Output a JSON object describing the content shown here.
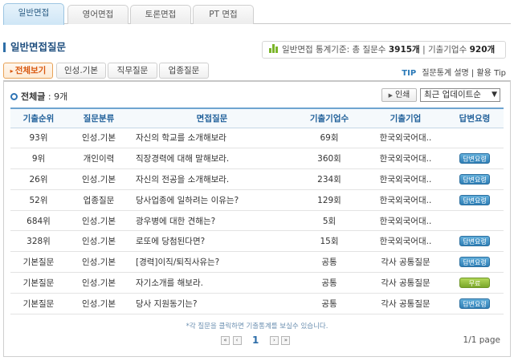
{
  "top_tabs": [
    {
      "label": "일반면접",
      "active": true
    },
    {
      "label": "영어면접",
      "active": false
    },
    {
      "label": "토론면접",
      "active": false
    },
    {
      "label": "PT 면접",
      "active": false
    }
  ],
  "section_title": "일반면접질문",
  "stats": {
    "prefix": "일반면접 통계기준: 총 질문수",
    "question_count": "3915개",
    "separator": "|",
    "appear_label": "기출기업수",
    "company_count": "920개"
  },
  "sub_tabs": [
    {
      "label": "전체보기",
      "active": true
    },
    {
      "label": "인성.기본",
      "active": false
    },
    {
      "label": "직무질문",
      "active": false
    },
    {
      "label": "업종질문",
      "active": false
    }
  ],
  "tip": {
    "label": "TIP",
    "link1": "질문통계 설명",
    "sep": "|",
    "link2": "활용 Tip"
  },
  "list_header": {
    "label": "전체글",
    "count": ": 9개"
  },
  "print_label": "인쇄",
  "sort_select": {
    "value": "최근 업데이트순"
  },
  "table": {
    "columns": [
      "기출순위",
      "질문분류",
      "면접질문",
      "기출기업수",
      "기출기업",
      "답변요령"
    ],
    "rows": [
      {
        "rank": "93위",
        "category": "인성.기본",
        "question": "자신의 학교를 소개해보라",
        "count": "69회",
        "company": "한국외국어대..",
        "badge": ""
      },
      {
        "rank": "9위",
        "category": "개인이력",
        "question": "직장경력에 대해 말해보라.",
        "count": "360회",
        "company": "한국외국어대..",
        "badge": "답변요령"
      },
      {
        "rank": "26위",
        "category": "인성.기본",
        "question": "자신의 전공을 소개해보라.",
        "count": "234회",
        "company": "한국외국어대..",
        "badge": "답변요령"
      },
      {
        "rank": "52위",
        "category": "업종질문",
        "question": "당사업종에 일하려는 이유는?",
        "count": "129회",
        "company": "한국외국어대..",
        "badge": "답변요령"
      },
      {
        "rank": "684위",
        "category": "인성.기본",
        "question": "광우병에 대한 견해는?",
        "count": "5회",
        "company": "한국외국어대..",
        "badge": ""
      },
      {
        "rank": "328위",
        "category": "인성.기본",
        "question": "로또에 당첨된다면?",
        "count": "15회",
        "company": "한국외국어대..",
        "badge": "답변요령"
      },
      {
        "rank": "기본질문",
        "category": "인성.기본",
        "question": "[경력]이직/퇴직사유는?",
        "count": "공통",
        "company": "각사 공통질문",
        "badge": "답변요령"
      },
      {
        "rank": "기본질문",
        "category": "인성.기본",
        "question": "자기소개를 해보라.",
        "count": "공통",
        "company": "각사 공통질문",
        "badge": "무료"
      },
      {
        "rank": "기본질문",
        "category": "인성.기본",
        "question": "당사 지원동기는?",
        "count": "공통",
        "company": "각사 공통질문",
        "badge": "답변요령"
      }
    ]
  },
  "note": "*각 질문을 클릭하면 기출통계를 보실수 있습니다.",
  "pager": {
    "current": "1",
    "first": "«",
    "prev": "‹",
    "next": "›",
    "last": "»"
  },
  "page_info": "1/1 page"
}
